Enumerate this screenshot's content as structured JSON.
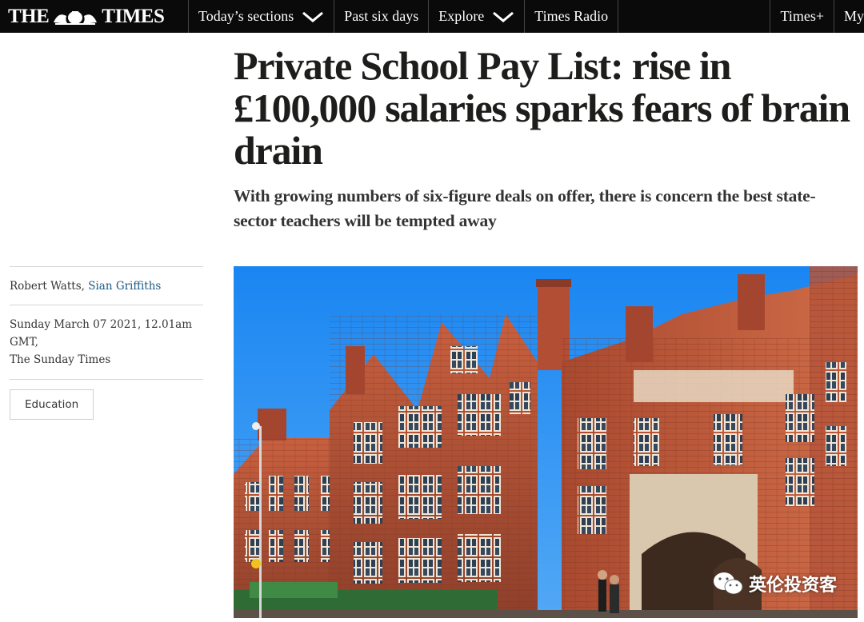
{
  "nav": {
    "logo_left": "THE",
    "logo_right": "TIMES",
    "items": [
      {
        "label": "Today’s sections",
        "has_dropdown": true
      },
      {
        "label": "Past six days",
        "has_dropdown": false
      },
      {
        "label": "Explore",
        "has_dropdown": true
      },
      {
        "label": "Times Radio",
        "has_dropdown": false
      }
    ],
    "right_items": [
      {
        "label": "Times+"
      },
      {
        "label": "My"
      }
    ]
  },
  "article": {
    "headline": "Private School Pay List: rise in £100,000 salaries sparks fears of brain drain",
    "standfirst": "With growing numbers of six-figure deals on offer, there is concern the best state-sector teachers will be tempted away",
    "authors": {
      "primary": "Robert Watts,",
      "secondary": "Sian Griffiths"
    },
    "date": "Sunday March 07 2021, 12.01am GMT,",
    "publication": "The Sunday Times",
    "tag": "Education"
  },
  "hero_image": {
    "icon": "building-photo",
    "watermark_text": "英伦投资客",
    "watermark_icon": "wechat-icon"
  },
  "colors": {
    "nav_bg": "#0a0a0a",
    "link": "#1a5a85",
    "sky": "#1e88f0",
    "brick": "#b5553a"
  }
}
